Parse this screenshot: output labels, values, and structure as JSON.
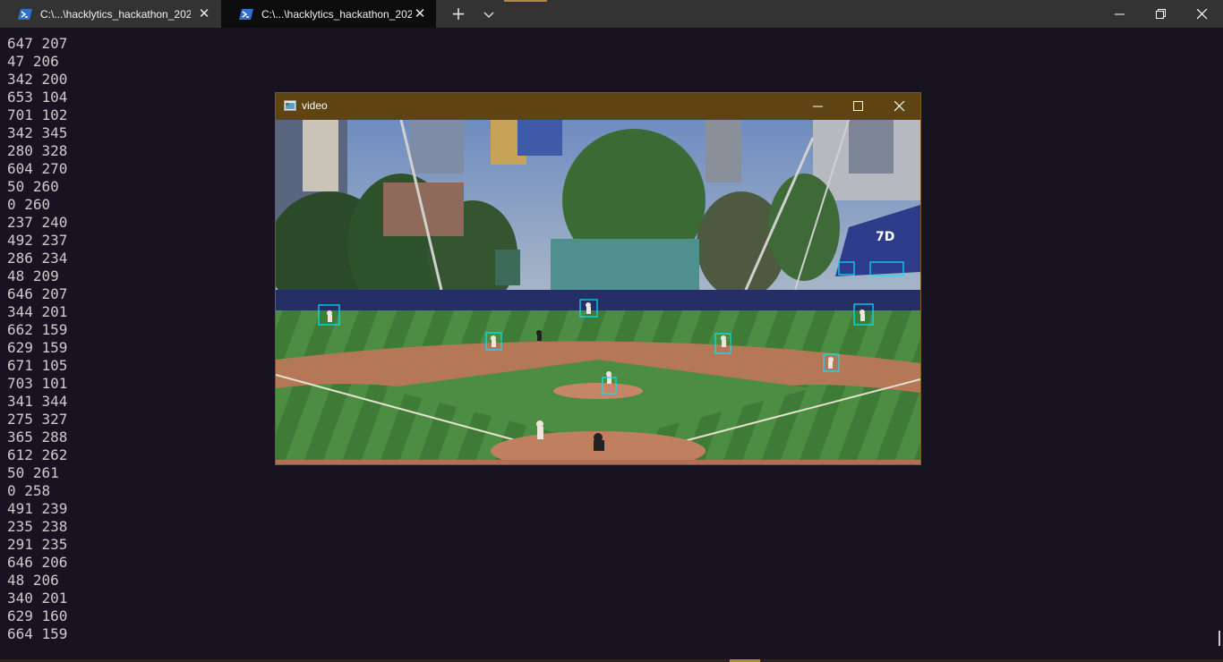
{
  "tabs": [
    {
      "label": "C:\\...\\hacklytics_hackathon_2022",
      "icon": "powershell-icon",
      "active": false
    },
    {
      "label": "C:\\...\\hacklytics_hackathon_2022",
      "icon": "powershell-icon",
      "active": true
    }
  ],
  "tabbar": {
    "new_tab_icon": "plus-icon",
    "dropdown_icon": "chevron-down-icon",
    "close_glyph": "✕",
    "plus_glyph": "+"
  },
  "terminal_lines": [
    "647 207",
    "47 206",
    "342 200",
    "653 104",
    "701 102",
    "342 345",
    "280 328",
    "604 270",
    "50 260",
    "0 260",
    "237 240",
    "492 237",
    "286 234",
    "48 209",
    "646 207",
    "344 201",
    "662 159",
    "629 159",
    "671 105",
    "703 101",
    "341 344",
    "275 327",
    "365 288",
    "612 262",
    "50 261",
    "0 258",
    "491 239",
    "235 238",
    "291 235",
    "646 206",
    "48 206",
    "340 201",
    "629 160",
    "664 159"
  ],
  "video_window": {
    "title": "video",
    "app_icon": "window-app-icon"
  },
  "colors": {
    "terminal_bg": "#181320",
    "terminal_text": "#cccccc",
    "tabbar_bg": "#333333",
    "active_tab_bg": "#0c0c0c",
    "video_titlebar": "#5e4413",
    "detection_box": "#00e5ff"
  }
}
